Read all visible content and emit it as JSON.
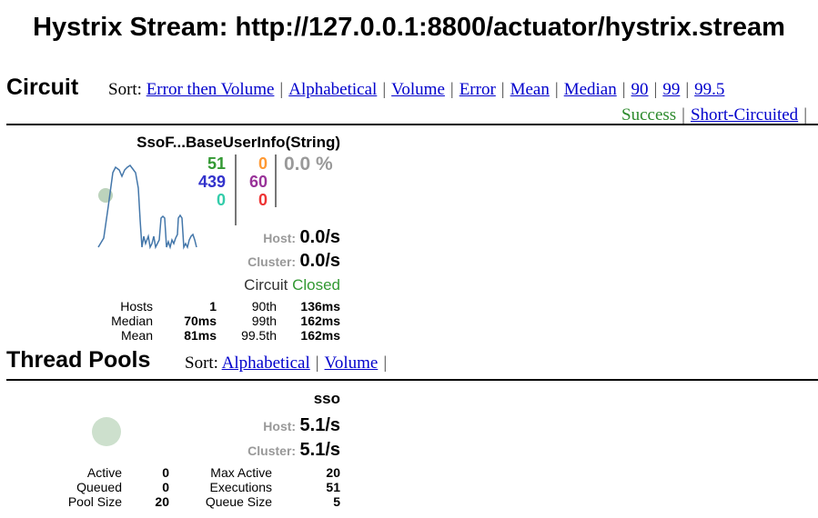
{
  "page": {
    "title": "Hystrix Stream: http://127.0.0.1:8800/actuator/hystrix.stream"
  },
  "circuit_section": {
    "title": "Circuit",
    "sort_label": "Sort:",
    "sort_links": [
      "Error then Volume",
      "Alphabetical",
      "Volume",
      "Error",
      "Mean",
      "Median",
      "90",
      "99",
      "99.5"
    ],
    "legend_links": [
      "Success",
      "Short-Circuited"
    ],
    "separator": "|"
  },
  "circuit": {
    "name": "SsoF...BaseUserInfo(String)",
    "counts": {
      "success": "51",
      "short_circuited": "439",
      "bad_request": "0",
      "timeout": "0",
      "rejected": "60",
      "failure": "0"
    },
    "error_percent": "0.0 %",
    "host_label": "Host:",
    "host_rate": "0.0/s",
    "cluster_label": "Cluster:",
    "cluster_rate": "0.0/s",
    "status_label": "Circuit",
    "status_value": "Closed",
    "stats": {
      "hosts_label": "Hosts",
      "hosts_value": "1",
      "median_label": "Median",
      "median_value": "70ms",
      "mean_label": "Mean",
      "mean_value": "81ms",
      "p90_label": "90th",
      "p90_value": "136ms",
      "p99_label": "99th",
      "p99_value": "162ms",
      "p995_label": "99.5th",
      "p995_value": "162ms"
    },
    "colors": {
      "success": "#339933",
      "short_circuited": "#3333cc",
      "bad_request": "#33ccaa",
      "timeout": "#ff9933",
      "rejected": "#993399",
      "failure": "#ee3333",
      "error_pct": "#999999",
      "sparkline": "#4477aa",
      "bubble": "#bcd3bc"
    }
  },
  "thread_pools_section": {
    "title": "Thread Pools",
    "sort_label": "Sort:",
    "sort_links": [
      "Alphabetical",
      "Volume"
    ],
    "separator": "|"
  },
  "thread_pool": {
    "name": "sso",
    "host_label": "Host:",
    "host_rate": "5.1/s",
    "cluster_label": "Cluster:",
    "cluster_rate": "5.1/s",
    "stats": {
      "active_label": "Active",
      "active_value": "0",
      "queued_label": "Queued",
      "queued_value": "0",
      "pool_size_label": "Pool Size",
      "pool_size_value": "20",
      "max_active_label": "Max Active",
      "max_active_value": "20",
      "executions_label": "Executions",
      "executions_value": "51",
      "queue_size_label": "Queue Size",
      "queue_size_value": "5"
    }
  }
}
